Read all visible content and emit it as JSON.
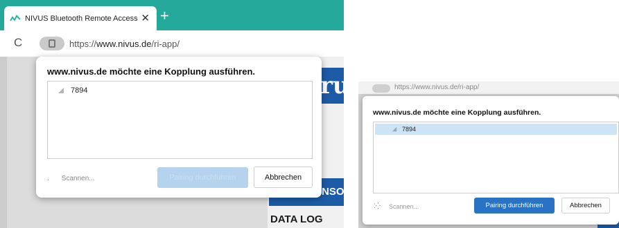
{
  "left": {
    "tab": {
      "title": "NIVUS Bluetooth Remote Access",
      "close": "✕",
      "new_tab": "+"
    },
    "address": {
      "reload": "C",
      "scheme": "https://",
      "host": "www.nivus.de",
      "path": "/ri-app/"
    },
    "page": {
      "logo_fragment": "ru",
      "sensor_fragment": "NSO",
      "data_log": "DATA LOG"
    },
    "dialog": {
      "title": "www.nivus.de möchte eine Kopplung ausführen.",
      "devices": [
        {
          "name": "7894"
        }
      ],
      "spinner": ".",
      "scanning": "Scannen...",
      "pair_button": "Pairing durchführen",
      "cancel_button": "Abbrechen"
    }
  },
  "right": {
    "address": {
      "url": "https://www.nivus.de/ri-app/"
    },
    "dialog": {
      "title": "www.nivus.de möchte eine Kopplung ausführen.",
      "devices": [
        {
          "name": "7894",
          "selected": true
        }
      ],
      "spinner": "⁚⁛",
      "scanning": "Scannen...",
      "pair_button": "Pairing durchführen",
      "cancel_button": "Abbrechen"
    }
  },
  "colors": {
    "tabbar": "#25a99b",
    "brand_blue": "#1e5ba6",
    "pair_button_enabled": "#2a72c3",
    "pair_button_disabled": "#b6d3ee",
    "selected_row": "#cde3f6"
  },
  "icons": [
    "nivus-favicon-icon",
    "close-icon",
    "new-tab-icon",
    "reload-icon",
    "lock-icon",
    "bluetooth-device-icon",
    "scanning-spinner-icon"
  ]
}
